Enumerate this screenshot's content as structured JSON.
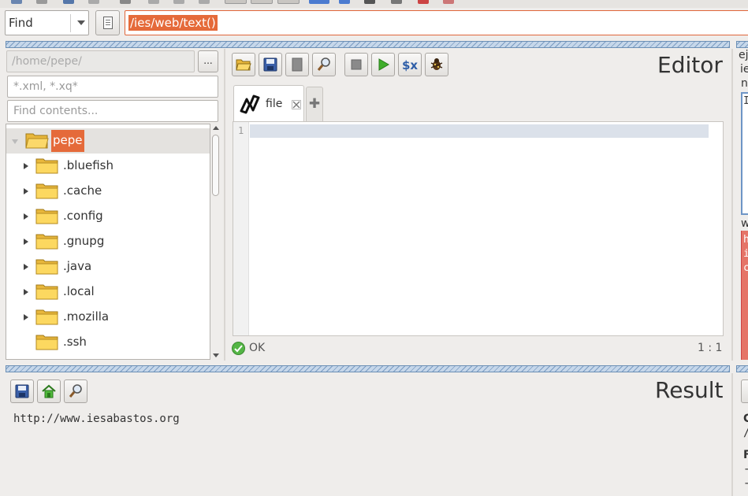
{
  "find_bar": {
    "mode": "Find",
    "expression": "/ies/web/text()"
  },
  "file_browser": {
    "path_placeholder": "/home/pepe/",
    "browse_label": "...",
    "filter_placeholder": "*.xml, *.xq*",
    "contents_placeholder": "Find contents...",
    "root": "pepe",
    "folders": [
      ".bluefish",
      ".cache",
      ".config",
      ".gnupg",
      ".java",
      ".local",
      ".mozilla",
      ".ssh"
    ]
  },
  "editor": {
    "title": "Editor",
    "tab_label": "file",
    "line_number": "1",
    "status": "OK",
    "cursor": "1 : 1"
  },
  "result": {
    "title": "Result",
    "output": "http://www.iesabastos.org"
  },
  "right_panel": {
    "lines": [
      "ej",
      "ie",
      "n",
      "I",
      "w",
      "h",
      "i",
      "c",
      "C",
      "/",
      "F",
      "-",
      "-"
    ]
  },
  "colors": {
    "accent_selection": "#e56a3a",
    "divider_blue": "#7b9cc2",
    "ok_green": "#54b545",
    "error_red": "#e57467"
  }
}
